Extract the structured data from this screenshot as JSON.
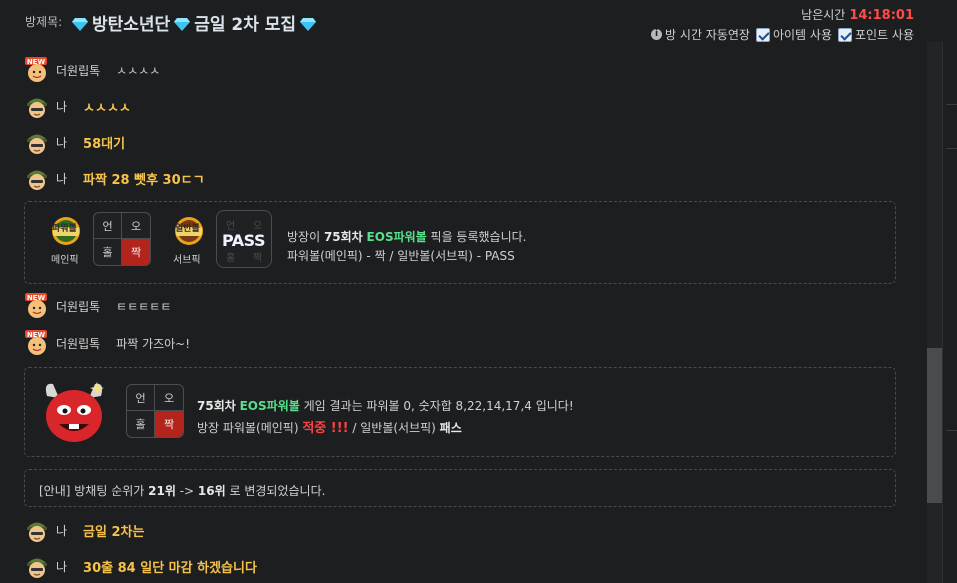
{
  "header": {
    "room_label": "방제목:",
    "room_title": "방탄소년단",
    "room_title2": "금일 2차 모집",
    "timer_label": "남은시간",
    "timer_value": "14:18:01",
    "auto_extend": "방 시간 자동연장",
    "item_use": "아이템 사용",
    "point_use": "포인트 사용"
  },
  "messages": [
    {
      "name": "더원립톡",
      "text": "ㅅㅅㅅㅅ",
      "me": false
    },
    {
      "name": "나",
      "text": "ㅅㅅㅅㅅ",
      "me": true
    },
    {
      "name": "나",
      "text": "58대기",
      "me": true
    },
    {
      "name": "나",
      "text": "파짝 28 뻿후 30ㄷㄱ",
      "me": true
    },
    {
      "name": "더원립톡",
      "text": "ㅌㅌㅌㅌㅌ",
      "me": false
    },
    {
      "name": "더원립톡",
      "text": "파짝 가즈아~!",
      "me": false
    },
    {
      "name": "나",
      "text": "금일 2차는",
      "me": true
    },
    {
      "name": "나",
      "text": "30출 84 일단 마감 하겠습니다",
      "me": true
    }
  ],
  "pick_card": {
    "main_ball": "파워볼",
    "main_label": "메인픽",
    "sub_ball": "일반볼",
    "sub_label": "서브픽",
    "grid": [
      "언",
      "오",
      "홀",
      "짝"
    ],
    "pass": "PASS",
    "line1_pre": "방장이 ",
    "line1_round": "75회차",
    "line1_game": "EOS파워볼",
    "line1_post": " 픽을 등록했습니다.",
    "line2": "파워볼(메인픽) - 짝 / 일반볼(서브픽) - PASS"
  },
  "result_card": {
    "grid": [
      "언",
      "오",
      "홀",
      "짝"
    ],
    "line1_round": "75회차",
    "line1_game": "EOS파워볼",
    "line1_post": " 게임 결과는 파워볼 0, 숫자합 8,22,14,17,4 입니다!",
    "line2_pre": "방장 파워볼(메인픽) ",
    "line2_hit": "적중 !!!",
    "line2_mid": " / 일반볼(서브픽) ",
    "line2_end": "패스"
  },
  "notice": {
    "pre": "[안내] 방채팅 순위가 ",
    "from": "21위",
    "arrow": " -> ",
    "to": "16위",
    "post": " 로 변경되었습니다."
  },
  "colors": {
    "accent_gold": "#f6c24a",
    "timer_red": "#ff4a4a",
    "game_green": "#56e08a",
    "hit_red": "#b3251c"
  }
}
